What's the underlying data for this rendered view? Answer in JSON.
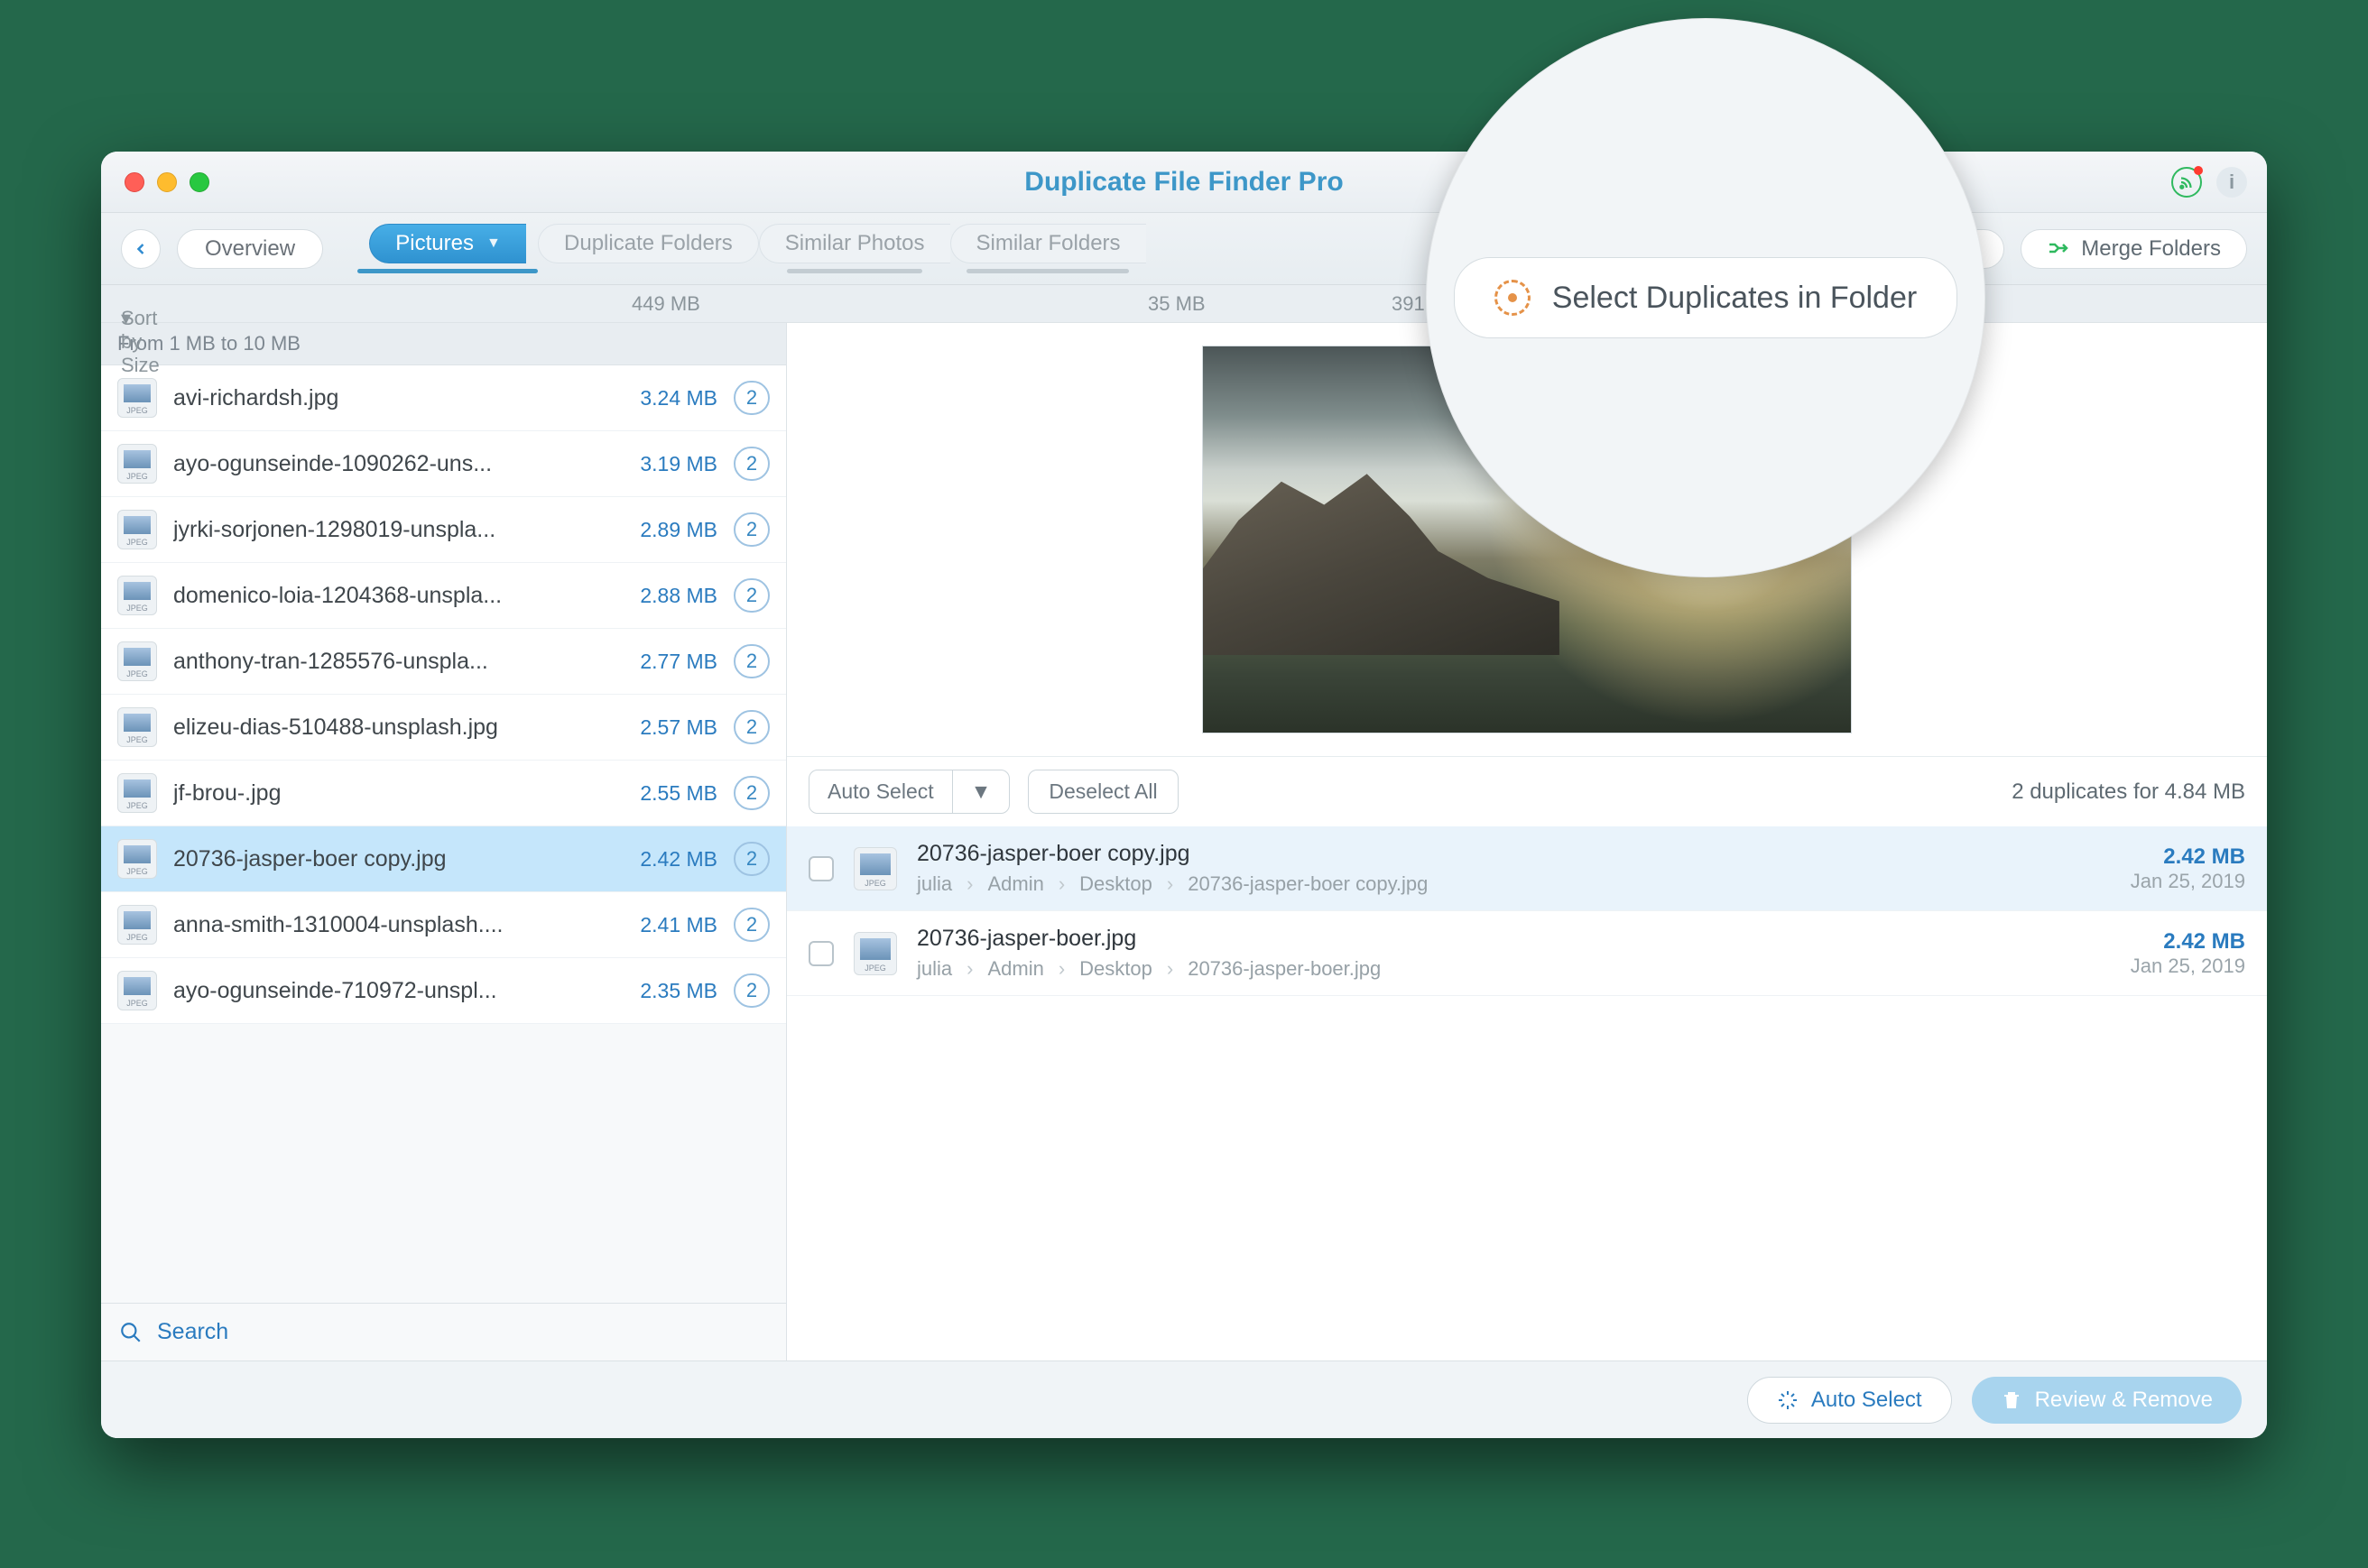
{
  "window": {
    "title": "Duplicate File Finder Pro"
  },
  "toolbar": {
    "overview_label": "Overview",
    "tabs": [
      {
        "label": "Pictures",
        "size": "449 MB"
      },
      {
        "label": "Duplicate Folders",
        "size": ""
      },
      {
        "label": "Similar Photos",
        "size": "35 MB"
      },
      {
        "label": "Similar Folders",
        "size": "391 MB"
      }
    ],
    "right": {
      "select_in_folder": "Select Duplicates in Folder",
      "merge_folders": "Merge Folders"
    }
  },
  "sidebar": {
    "sort_label": "Sort by Size",
    "group_header": "From 1 MB to 10 MB",
    "search_placeholder": "Search",
    "files": [
      {
        "name": "avi-richardsh.jpg",
        "size": "3.24 MB",
        "count": "2"
      },
      {
        "name": "ayo-ogunseinde-1090262-uns...",
        "size": "3.19 MB",
        "count": "2"
      },
      {
        "name": "jyrki-sorjonen-1298019-unspla...",
        "size": "2.89 MB",
        "count": "2"
      },
      {
        "name": "domenico-loia-1204368-unspla...",
        "size": "2.88 MB",
        "count": "2"
      },
      {
        "name": "anthony-tran-1285576-unspla...",
        "size": "2.77 MB",
        "count": "2"
      },
      {
        "name": "elizeu-dias-510488-unsplash.jpg",
        "size": "2.57 MB",
        "count": "2"
      },
      {
        "name": "jf-brou-.jpg",
        "size": "2.55 MB",
        "count": "2"
      },
      {
        "name": "20736-jasper-boer copy.jpg",
        "size": "2.42 MB",
        "count": "2"
      },
      {
        "name": "anna-smith-1310004-unsplash....",
        "size": "2.41 MB",
        "count": "2"
      },
      {
        "name": "ayo-ogunseinde-710972-unspl...",
        "size": "2.35 MB",
        "count": "2"
      }
    ],
    "selected_index": 7
  },
  "detail": {
    "auto_select_label": "Auto Select",
    "deselect_all_label": "Deselect All",
    "summary": "2 duplicates for 4.84 MB",
    "duplicates": [
      {
        "name": "20736-jasper-boer copy.jpg",
        "path": [
          "julia",
          "Admin",
          "Desktop",
          "20736-jasper-boer copy.jpg"
        ],
        "size": "2.42 MB",
        "date": "Jan 25, 2019",
        "highlighted": true
      },
      {
        "name": "20736-jasper-boer.jpg",
        "path": [
          "julia",
          "Admin",
          "Desktop",
          "20736-jasper-boer.jpg"
        ],
        "size": "2.42 MB",
        "date": "Jan 25, 2019",
        "highlighted": false
      }
    ]
  },
  "footer": {
    "auto_select": "Auto Select",
    "review_remove": "Review & Remove"
  },
  "magnifier": {
    "label": "Select Duplicates in Folder"
  }
}
